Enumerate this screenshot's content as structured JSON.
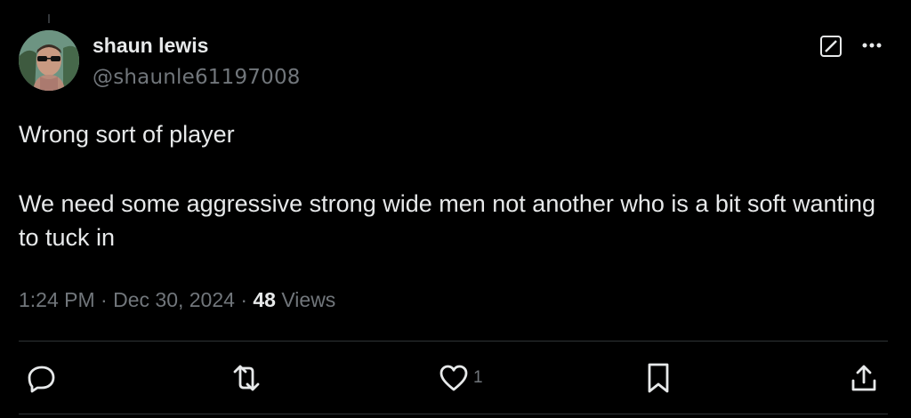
{
  "tweet": {
    "author": {
      "display_name": "shaun lewis",
      "handle": "@shaunle61197008"
    },
    "text_line1": "Wrong sort of player",
    "text_line2": "We need some aggressive strong wide men not another who is a bit soft wanting to tuck in",
    "time": "1:24 PM",
    "date": "Dec 30, 2024",
    "views_count": "48",
    "views_label": "Views"
  },
  "actions": {
    "reply_icon": "reply-icon",
    "retweet_icon": "retweet-icon",
    "like_icon": "heart-icon",
    "like_count": "1",
    "bookmark_icon": "bookmark-icon",
    "share_icon": "share-icon"
  },
  "colors": {
    "background": "#000000",
    "primary_text": "#e7e9ea",
    "secondary_text": "#71767b",
    "divider": "#2f3336"
  }
}
